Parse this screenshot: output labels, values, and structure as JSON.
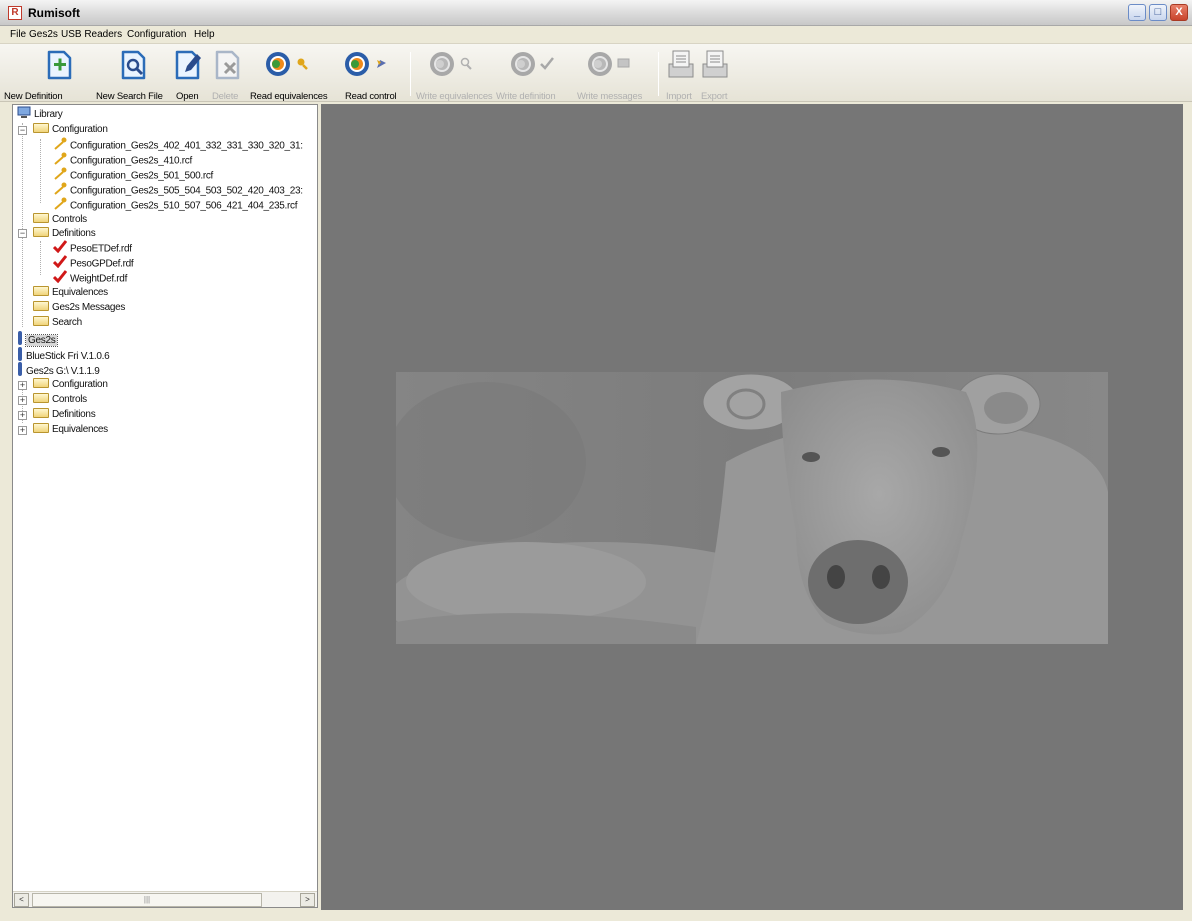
{
  "window": {
    "title": "Rumisoft",
    "app_icon": "R",
    "controls": {
      "minimize": "_",
      "maximize": "□",
      "close": "X"
    }
  },
  "menu": [
    "File",
    "Ges2s",
    "USB Readers",
    "Configuration",
    "Help"
  ],
  "toolbar": {
    "new_definition": "New Definition",
    "new_search_file": "New Search File",
    "open": "Open",
    "delete": "Delete",
    "read_equivalences": "Read equivalences",
    "read_control": "Read control",
    "write_equivalences": "Write equivalences",
    "write_definition": "Write definition",
    "write_messages": "Write messages",
    "import": "Import",
    "export": "Export"
  },
  "tree": {
    "library": "Library",
    "configuration": "Configuration",
    "config_files": [
      "Configuration_Ges2s_402_401_332_331_330_320_31:",
      "Configuration_Ges2s_410.rcf",
      "Configuration_Ges2s_501_500.rcf",
      "Configuration_Ges2s_505_504_503_502_420_403_23:",
      "Configuration_Ges2s_510_507_506_421_404_235.rcf"
    ],
    "controls": "Controls",
    "definitions": "Definitions",
    "definition_files": [
      "PesoETDef.rdf",
      "PesoGPDef.rdf",
      "WeightDef.rdf"
    ],
    "equivalences": "Equivalences",
    "ges2s_messages": "Ges2s Messages",
    "search": "Search",
    "ges2s": "Ges2s",
    "bluestick": "BlueStick Fri V.1.0.6",
    "ges2s_version": "Ges2s G:\\ V.1.1.9",
    "device_folders": [
      "Configuration",
      "Controls",
      "Definitions",
      "Equivalences"
    ]
  },
  "scrollbar": {
    "left": "<",
    "right": ">",
    "grip": "|||"
  },
  "icons": {
    "new_definition": "new-definition-icon",
    "new_search_file": "new-search-file-icon",
    "open": "open-icon",
    "delete": "delete-icon",
    "read_equivalences": "read-equivalences-icon",
    "read_control": "read-control-icon",
    "write_equivalences": "write-equivalences-icon",
    "write_definition": "write-definition-icon",
    "write_messages": "write-messages-icon",
    "import": "import-icon",
    "export": "export-icon"
  },
  "colors": {
    "accent_green": "#3a9a3a",
    "accent_blue": "#2b5da8",
    "check_red": "#d01818",
    "key_yellow": "#e0a61a",
    "workspace": "#767676"
  }
}
